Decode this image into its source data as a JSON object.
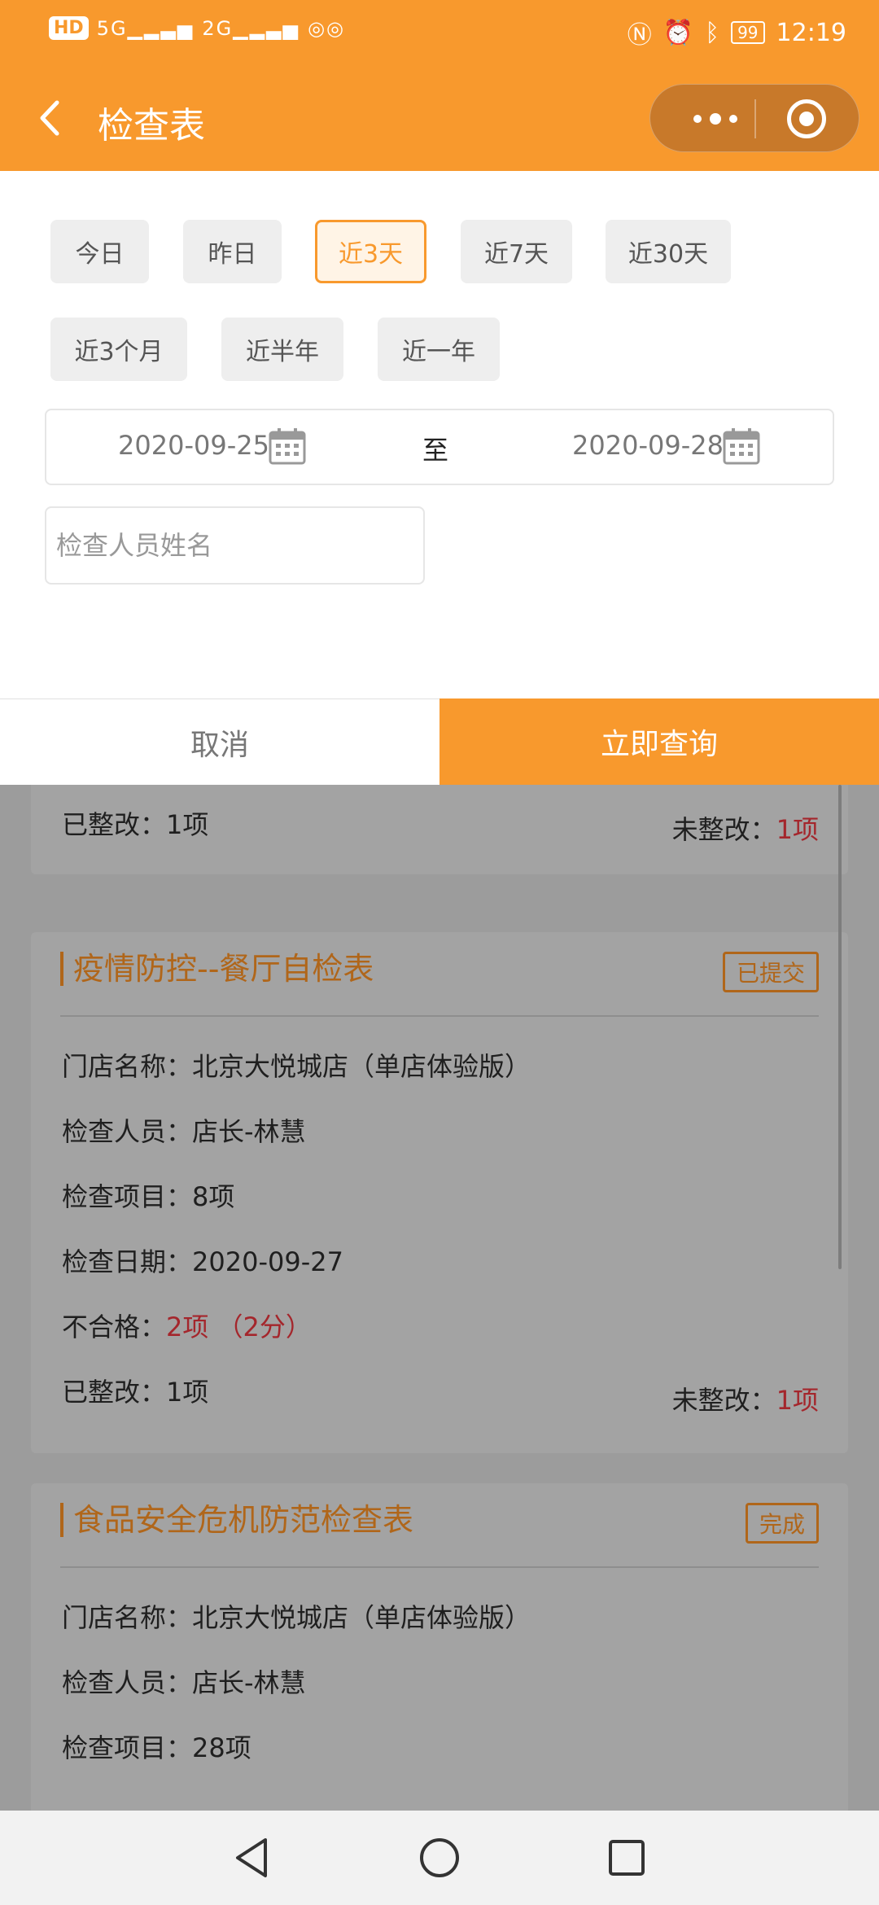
{
  "status_bar": {
    "hd": "HD",
    "signal1": "5G",
    "signal2": "2G",
    "battery": "99",
    "time": "12:19"
  },
  "header": {
    "title": "检查表",
    "back_icon": "chevron-left-icon",
    "more_icon": "more-dots-icon",
    "close_icon": "target-close-icon"
  },
  "filter": {
    "chips": [
      "今日",
      "昨日",
      "近3天",
      "近7天",
      "近30天",
      "近3个月",
      "近半年",
      "近一年"
    ],
    "active_chip": "近3天",
    "start_date": "2020-09-25",
    "to_label": "至",
    "end_date": "2020-09-28",
    "name_placeholder": "检查人员姓名"
  },
  "actions": {
    "cancel": "取消",
    "query": "立即查询"
  },
  "list": {
    "partial_card": {
      "rectified": "已整改：1项",
      "unrectified_label": "未整改：",
      "unrectified_value": "1项"
    },
    "cards": [
      {
        "title": "疫情防控--餐厅自检表",
        "status": "已提交",
        "store": "门店名称：北京大悦城店（单店体验版）",
        "inspector": "检查人员：店长-林慧",
        "items": "检查项目：8项",
        "date": "检查日期：2020-09-27",
        "fail_label": "不合格：",
        "fail_value": "2项 （2分）",
        "rectified": "已整改：1项",
        "unrectified_label": "未整改：",
        "unrectified_value": "1项"
      },
      {
        "title": "食品安全危机防范检查表",
        "status": "完成",
        "store": "门店名称：北京大悦城店（单店体验版）",
        "inspector": "检查人员：店长-林慧",
        "items": "检查项目：28项"
      }
    ]
  },
  "colors": {
    "accent": "#f8992d",
    "danger": "#a4262c"
  }
}
